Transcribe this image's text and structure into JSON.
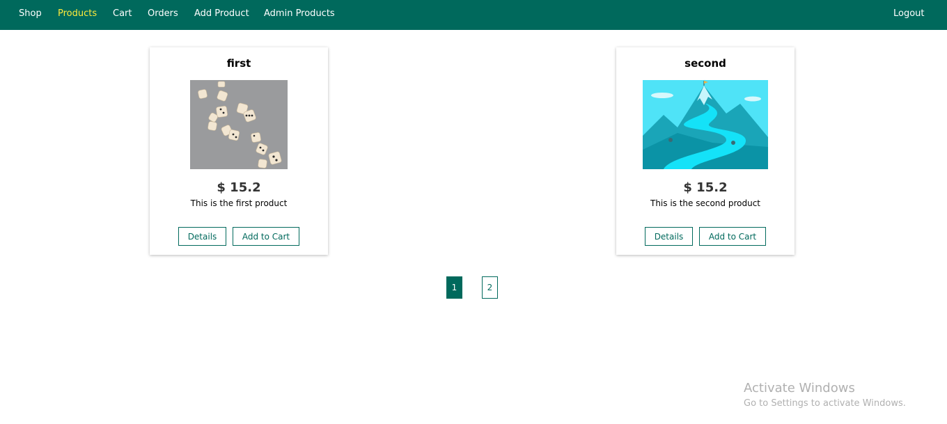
{
  "nav": {
    "items": [
      {
        "label": "Shop"
      },
      {
        "label": "Products"
      },
      {
        "label": "Cart"
      },
      {
        "label": "Orders"
      },
      {
        "label": "Add Product"
      },
      {
        "label": "Admin Products"
      }
    ],
    "active": "Products",
    "logout": "Logout"
  },
  "products": [
    {
      "title": "first",
      "image": "dice-photo",
      "price": "$ 15.2",
      "description": "This is the first product",
      "details_label": "Details",
      "cart_label": "Add to Cart"
    },
    {
      "title": "second",
      "image": "mountain-illustration",
      "price": "$ 15.2",
      "description": "This is the second product",
      "details_label": "Details",
      "cart_label": "Add to Cart"
    }
  ],
  "pagination": {
    "pages": [
      "1",
      "2"
    ],
    "current": "1"
  },
  "watermark": {
    "title": "Activate Windows",
    "subtitle": "Go to Settings to activate Windows."
  },
  "colors": {
    "primary": "#00695c",
    "active_nav": "#ffeb3b"
  }
}
